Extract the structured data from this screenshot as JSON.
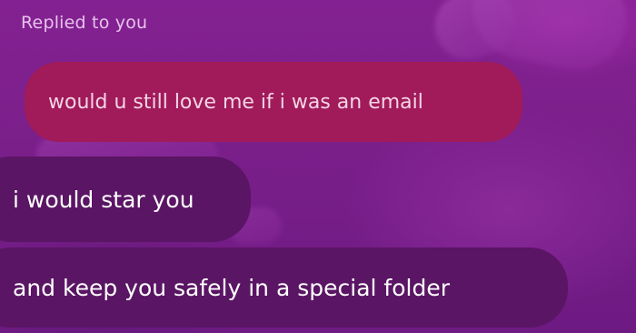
{
  "thread": {
    "reply_label": "Replied to you",
    "quoted_message": {
      "text": "would u still love me if i was an email"
    },
    "messages": [
      {
        "text": "i would star you"
      },
      {
        "text": "and keep you safely in a special folder"
      }
    ]
  },
  "colors": {
    "background": "#7c1f88",
    "quoted_bubble": "#a11a59",
    "message_bubble": "#5a1564",
    "label_text": "#e7c2ec",
    "message_text": "#ffffff"
  }
}
